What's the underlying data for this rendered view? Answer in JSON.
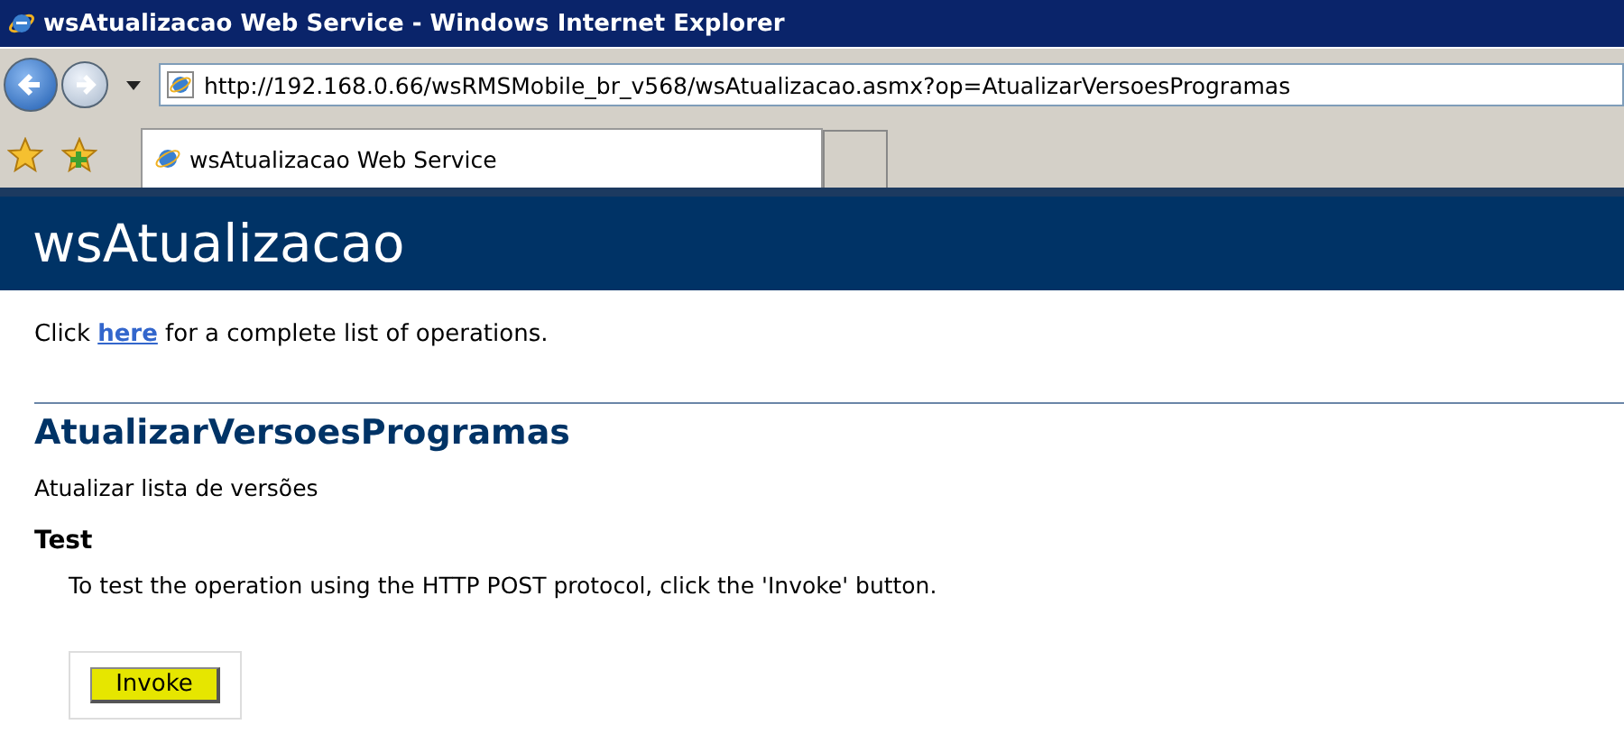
{
  "window": {
    "title": "wsAtualizacao Web Service - Windows Internet Explorer"
  },
  "address_bar": {
    "value": "http://192.168.0.66/wsRMSMobile_br_v568/wsAtualizacao.asmx?op=AtualizarVersoesProgramas"
  },
  "tabs": [
    {
      "label": "wsAtualizacao Web Service",
      "selected": true
    }
  ],
  "page": {
    "heading": "wsAtualizacao",
    "intro": {
      "before": "Click ",
      "link": "here",
      "after": " for a complete list of operations."
    },
    "operation": "AtualizarVersoesProgramas",
    "description": "Atualizar lista de versões",
    "test_heading": "Test",
    "test_text": "To test the operation using the HTTP POST protocol, click the 'Invoke' button.",
    "button": "Invoke"
  }
}
